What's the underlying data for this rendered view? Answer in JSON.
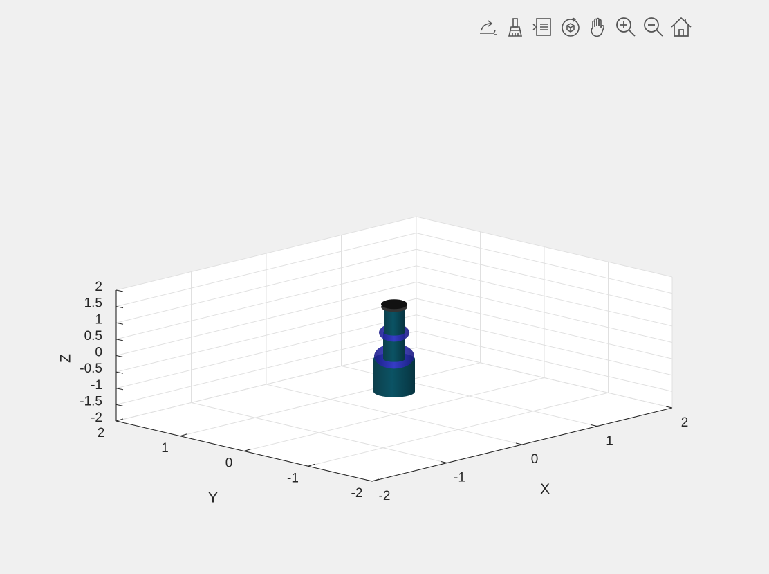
{
  "toolbar": {
    "items": [
      {
        "name": "export-icon"
      },
      {
        "name": "brush-icon"
      },
      {
        "name": "data-tips-icon"
      },
      {
        "name": "rotate-3d-icon"
      },
      {
        "name": "pan-icon"
      },
      {
        "name": "zoom-in-icon"
      },
      {
        "name": "zoom-out-icon"
      },
      {
        "name": "home-icon"
      }
    ]
  },
  "chart_data": {
    "type": "3d-surface",
    "xlabel": "X",
    "ylabel": "Y",
    "zlabel": "Z",
    "xlim": [
      -2,
      2
    ],
    "ylim": [
      -2,
      2
    ],
    "zlim": [
      -2,
      2
    ],
    "xticks": [
      "-2",
      "-1",
      "0",
      "1",
      "2"
    ],
    "yticks": [
      "-2",
      "-1",
      "0",
      "1",
      "2"
    ],
    "zticks": [
      "-2",
      "-1.5",
      "-1",
      "-0.5",
      "0",
      "0.5",
      "1",
      "1.5",
      "2"
    ],
    "grid": true,
    "colors": {
      "link": "#0a4a5a",
      "joint": "#2a2aa0",
      "end_effector": "#1a1a1a"
    }
  }
}
